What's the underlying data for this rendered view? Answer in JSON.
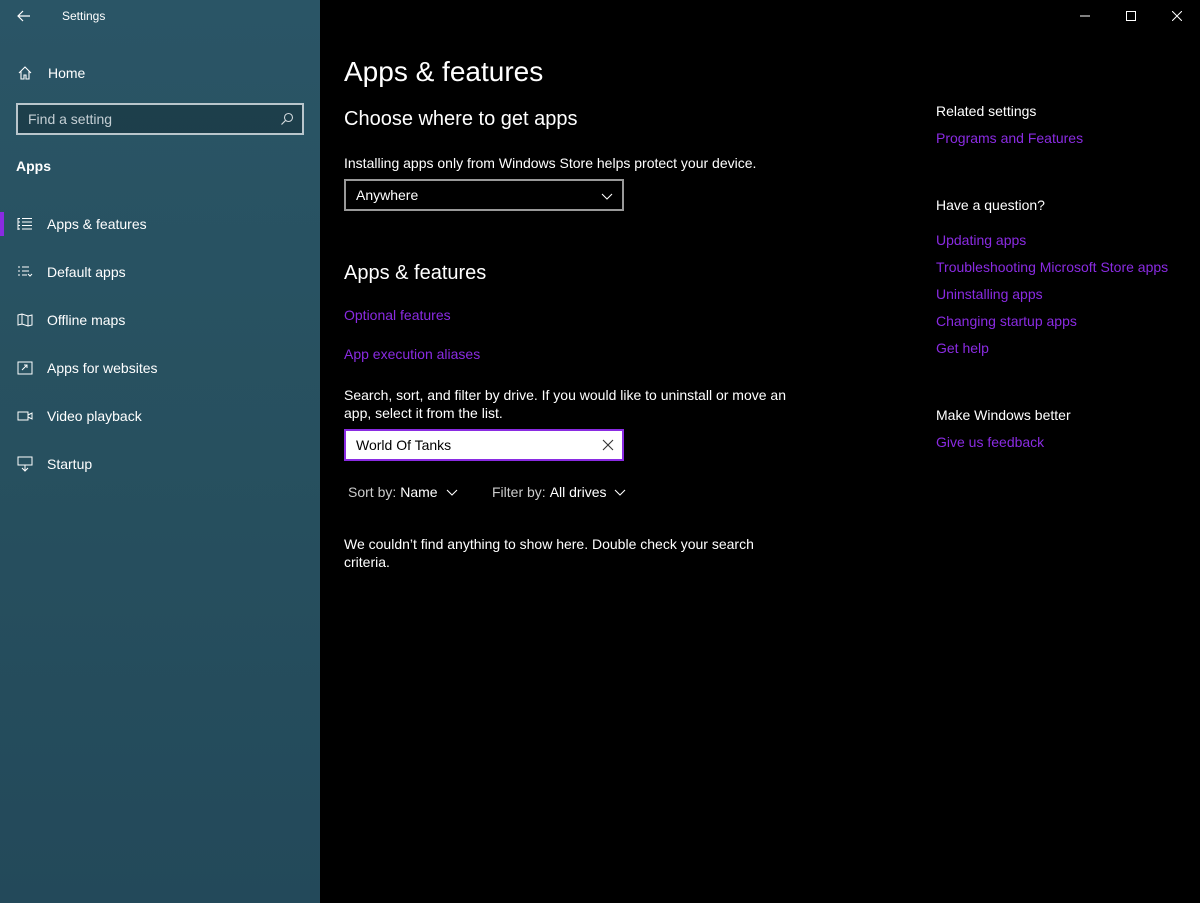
{
  "window": {
    "title": "Settings",
    "controls": {
      "minimize": "minimize-icon",
      "maximize": "maximize-icon",
      "close": "close-icon"
    }
  },
  "sidebar": {
    "home_label": "Home",
    "search_placeholder": "Find a setting",
    "section": "Apps",
    "items": [
      {
        "label": "Apps & features",
        "icon": "list-icon",
        "active": true
      },
      {
        "label": "Default apps",
        "icon": "default-apps-icon",
        "active": false
      },
      {
        "label": "Offline maps",
        "icon": "map-icon",
        "active": false
      },
      {
        "label": "Apps for websites",
        "icon": "open-in-app-icon",
        "active": false
      },
      {
        "label": "Video playback",
        "icon": "video-icon",
        "active": false
      },
      {
        "label": "Startup",
        "icon": "startup-icon",
        "active": false
      }
    ]
  },
  "main": {
    "page_title": "Apps & features",
    "choose_heading": "Choose where to get apps",
    "choose_desc": "Installing apps only from Windows Store helps protect your device.",
    "source_dropdown_value": "Anywhere",
    "features_heading": "Apps & features",
    "optional_features_link": "Optional features",
    "aliases_link": "App execution aliases",
    "search_desc": "Search, sort, and filter by drive. If you would like to uninstall or move an app, select it from the list.",
    "search_value": "World Of Tanks",
    "sort_label": "Sort by:",
    "sort_value": "Name",
    "filter_label": "Filter by:",
    "filter_value": "All drives",
    "empty_message": "We couldn’t find anything to show here. Double check your search criteria."
  },
  "related": {
    "related_heading": "Related settings",
    "programs_link": "Programs and Features",
    "question_heading": "Have a question?",
    "help_links": [
      "Updating apps",
      "Troubleshooting Microsoft Store apps",
      "Uninstalling apps",
      "Changing startup apps",
      "Get help"
    ],
    "better_heading": "Make Windows better",
    "feedback_link": "Give us feedback"
  },
  "colors": {
    "accent": "#8a2be2",
    "sidebar_bg": "#27505f",
    "main_bg": "#000000"
  }
}
